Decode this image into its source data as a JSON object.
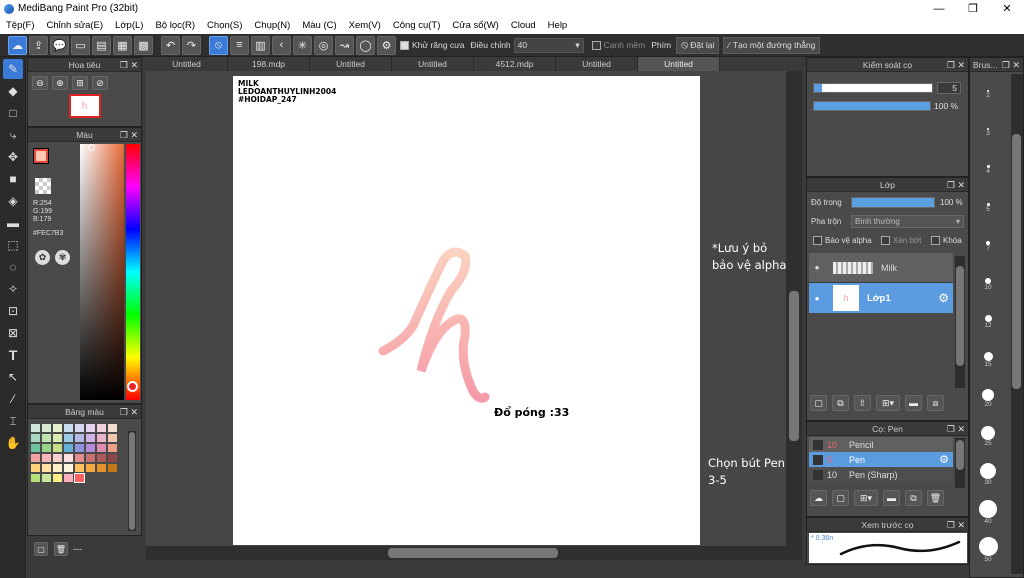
{
  "window": {
    "title": "MediBang Paint Pro (32bit)",
    "controls": [
      "—",
      "❐",
      "✕"
    ]
  },
  "menu": [
    "Tệp(F)",
    "Chỉnh sửa(E)",
    "Lớp(L)",
    "Bộ lọc(R)",
    "Chọn(S)",
    "Chụp(N)",
    "Màu (C)",
    "Xem(V)",
    "Công cụ(T)",
    "Cửa sổ(W)",
    "Cloud",
    "Help"
  ],
  "toolbar": {
    "antialias_label": "Khử răng cưa",
    "adjust_label": "Điều chỉnh",
    "adjust_value": "40",
    "smooth_edge_label": "Cạnh mềm",
    "key_label": "Phím",
    "reset_label": "Đặt lại",
    "create_line_label": "Tạo một đường thẳng"
  },
  "navigator": {
    "title": "Hoa tiêu"
  },
  "color_panel": {
    "title": "Màu",
    "r": "R:254",
    "g": "G:199",
    "b": "B:179",
    "hex": "#FEC7B3",
    "fg_color": "#FEC7B3",
    "bg_color": "#ffffff"
  },
  "palette_panel": {
    "title": "Bảng màu",
    "footer": "---"
  },
  "tabs": [
    "Untitled",
    "198.mdp",
    "Untitled",
    "Untitled",
    "4512.mdp",
    "Untitled",
    "Untitled"
  ],
  "canvas": {
    "watermark_line1": "MILK",
    "watermark_line2": "LEDOANTHUYLINH2004",
    "watermark_line3": "#HOIDAP_247",
    "glyph": "h",
    "annotation_opacity": "Đổ póng :33"
  },
  "notes": {
    "alpha_line1": "*Lưu ý bỏ",
    "alpha_line2": "bảo vệ alpha",
    "pen_line1": "Chọn bút Pen cỡ",
    "pen_line2": "3-5"
  },
  "brush_control": {
    "title": "Kiểm soát cọ",
    "size": "5",
    "opacity": "100 %"
  },
  "layer_panel": {
    "title": "Lớp",
    "opacity_label": "Độ trong",
    "opacity_value": "100 %",
    "blend_label": "Pha trộn",
    "blend_value": "Bình thường",
    "protect_alpha": "Bảo vệ alpha",
    "clipping": "Xén bớt",
    "lock": "Khóa",
    "layers": [
      {
        "name": "Milk",
        "selected": false
      },
      {
        "name": "Lớp1",
        "selected": true
      }
    ]
  },
  "brush_panel": {
    "title": "Cọ: Pen",
    "items": [
      {
        "size": "10",
        "name": "Pencil",
        "selected": false
      },
      {
        "size": "5",
        "name": "Pen",
        "selected": true
      },
      {
        "size": "10",
        "name": "Pen (Sharp)",
        "selected": false
      }
    ]
  },
  "preview_panel": {
    "title": "Xem trước cọ",
    "label": "* 0.36n"
  },
  "brush_size_panel": {
    "title": "Brus...",
    "sizes": [
      "2",
      "3",
      "4",
      "5",
      "7",
      "10",
      "12",
      "15",
      "20",
      "25",
      "30",
      "40",
      "50"
    ]
  }
}
